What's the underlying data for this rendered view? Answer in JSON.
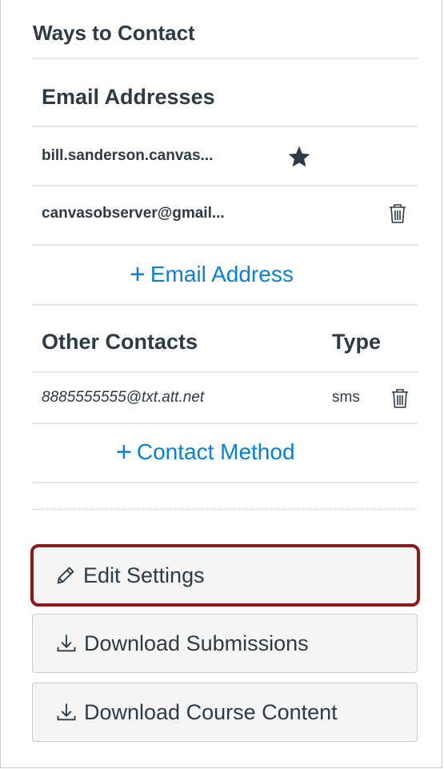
{
  "panel": {
    "title": "Ways to Contact",
    "email_section": {
      "heading": "Email Addresses",
      "items": [
        {
          "address": "bill.sanderson.canvas...",
          "icon": "star-icon"
        },
        {
          "address": "canvasobserver@gmail...",
          "icon": "trash-icon"
        }
      ],
      "add_label": "Email Address"
    },
    "other_section": {
      "heading": "Other Contacts",
      "type_heading": "Type",
      "items": [
        {
          "value": "8885555555@txt.att.net",
          "type": "sms",
          "icon": "trash-icon"
        }
      ],
      "add_label": "Contact Method"
    }
  },
  "buttons": {
    "edit_settings": "Edit Settings",
    "download_submissions": "Download Submissions",
    "download_course_content": "Download Course Content"
  },
  "colors": {
    "link": "#0b7fd0",
    "highlight_border": "#8b1a1a",
    "text": "#2d3b45"
  }
}
